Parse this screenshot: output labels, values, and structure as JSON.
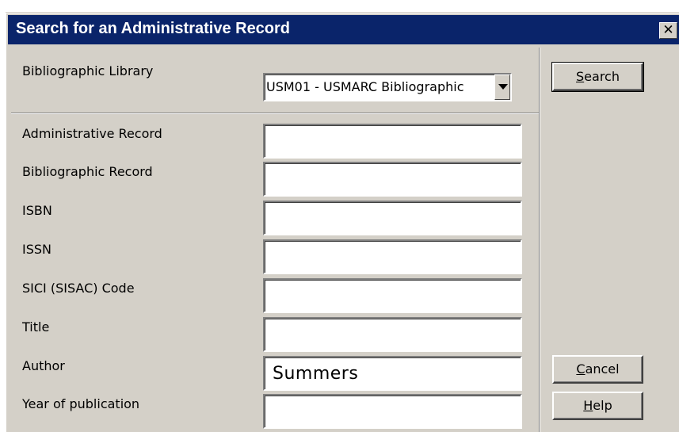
{
  "window": {
    "title": "Search for an Administrative Record",
    "close_symbol": "✕"
  },
  "library": {
    "label": "Bibliographic Library",
    "selected": "USM01 - USMARC Bibliographic"
  },
  "fields": [
    {
      "label": "Administrative Record",
      "value": ""
    },
    {
      "label": "Bibliographic Record",
      "value": ""
    },
    {
      "label": "ISBN",
      "value": ""
    },
    {
      "label": "ISSN",
      "value": ""
    },
    {
      "label": "SICI (SISAC) Code",
      "value": ""
    },
    {
      "label": "Title",
      "value": ""
    },
    {
      "label": "Author",
      "value": "Summers"
    },
    {
      "label": "Year of publication",
      "value": ""
    }
  ],
  "buttons": {
    "search": {
      "mnemonic": "S",
      "rest": "earch"
    },
    "cancel": {
      "mnemonic": "C",
      "rest": "ancel"
    },
    "help": {
      "mnemonic": "H",
      "rest": "elp"
    }
  }
}
